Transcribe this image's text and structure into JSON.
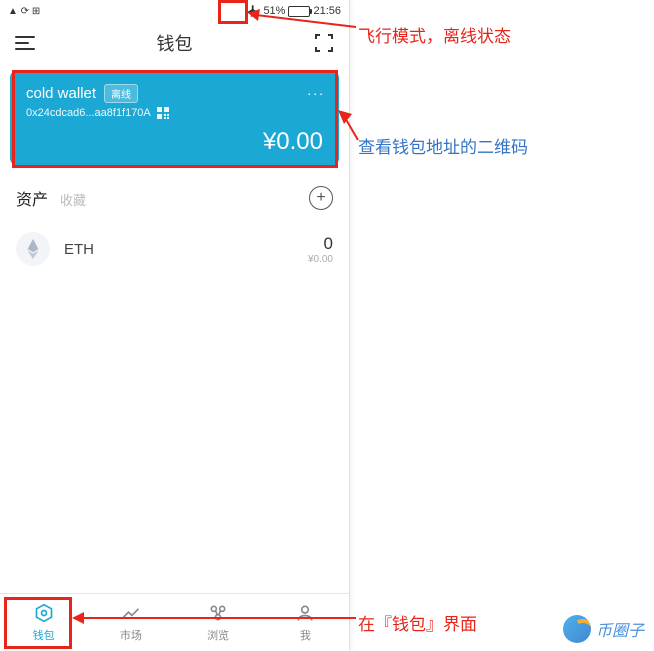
{
  "status_bar": {
    "left_icons": "▲ ⟳ ⊞",
    "battery_pct": "51%",
    "time": "21:56"
  },
  "header": {
    "title": "钱包"
  },
  "wallet_card": {
    "name": "cold wallet",
    "offline_badge": "离线",
    "address": "0x24cdcad6...aa8f1f170A",
    "balance": "¥0.00",
    "more": "..."
  },
  "assets": {
    "tab_active": "资产",
    "tab_inactive": "收藏",
    "add_label": "+",
    "list": [
      {
        "symbol": "ETH",
        "amount": "0",
        "fiat": "¥0.00"
      }
    ]
  },
  "tabbar": {
    "items": [
      {
        "label": "钱包"
      },
      {
        "label": "市场"
      },
      {
        "label": "浏览"
      },
      {
        "label": "我"
      }
    ]
  },
  "annotations": {
    "airplane": "飞行模式，离线状态",
    "qr": "查看钱包地址的二维码",
    "tab": "在『钱包』界面"
  },
  "watermark": "币圈子"
}
